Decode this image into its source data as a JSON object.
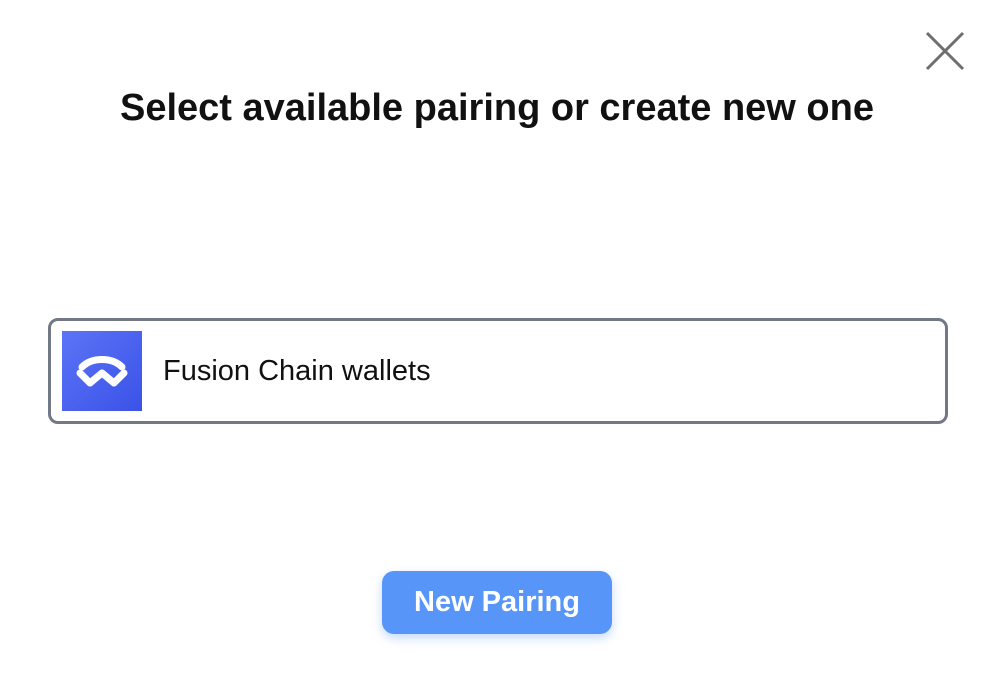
{
  "modal": {
    "title": "Select available pairing or create new one",
    "close_icon": "close-icon"
  },
  "pairings": [
    {
      "label": "Fusion Chain wallets",
      "icon": "walletconnect-logo-icon"
    }
  ],
  "actions": {
    "new_pairing_label": "New Pairing"
  },
  "colors": {
    "button_bg": "#5796f8",
    "logo_bg": "#4c66f0",
    "item_border": "#727886"
  }
}
